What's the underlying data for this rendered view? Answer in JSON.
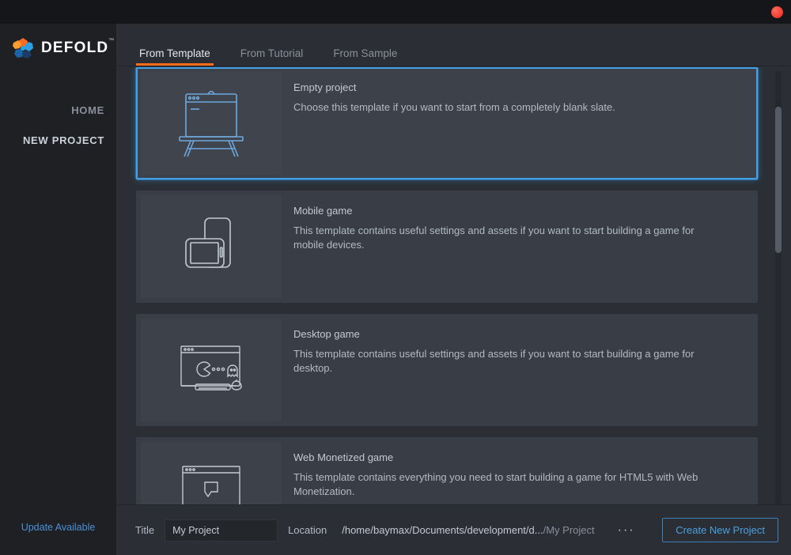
{
  "window": {
    "close_icon": "close-dot"
  },
  "sidebar": {
    "brand": "DEFOLD",
    "brand_tm": "™",
    "items": [
      {
        "label": "HOME",
        "active": false
      },
      {
        "label": "NEW PROJECT",
        "active": true
      }
    ],
    "update_link": "Update Available"
  },
  "tabs": [
    {
      "label": "From Template",
      "active": true
    },
    {
      "label": "From Tutorial",
      "active": false
    },
    {
      "label": "From Sample",
      "active": false
    }
  ],
  "templates": [
    {
      "title": "Empty project",
      "description": "Choose this template if you want to start from a completely blank slate.",
      "icon": "easel-whiteboard-icon",
      "selected": true
    },
    {
      "title": "Mobile game",
      "description": "This template contains useful settings and assets if you want to start building a game for mobile devices.",
      "icon": "mobile-devices-icon",
      "selected": false
    },
    {
      "title": "Desktop game",
      "description": "This template contains useful settings and assets if you want to start building a game for desktop.",
      "icon": "desktop-monitor-icon",
      "selected": false
    },
    {
      "title": "Web Monetized game",
      "description": "This template contains everything you need to start building a game for HTML5 with Web Monetization.",
      "icon": "browser-window-icon",
      "selected": false
    }
  ],
  "bottom_bar": {
    "title_label": "Title",
    "title_value": "My Project",
    "title_placeholder": "My Project",
    "location_label": "Location",
    "location_path": "/home/baymax/Documents/development/d...",
    "location_project": "/My Project",
    "browse_icon": "ellipsis-icon",
    "browse_label": "···",
    "create_button": "Create New Project"
  },
  "colors": {
    "accent_orange": "#ff6c1a",
    "accent_blue": "#41a0e8",
    "link_blue": "#4a90d9",
    "close_red": "#f73c3c",
    "bg_main": "#2b2f35",
    "bg_sidebar": "#1e2024",
    "bg_card": "#383d46"
  }
}
